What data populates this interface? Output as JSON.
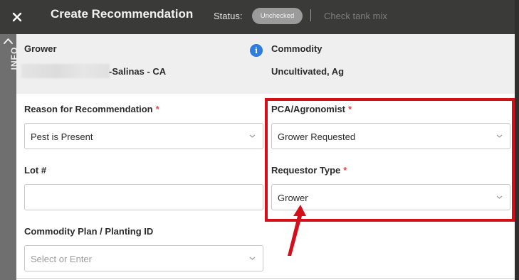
{
  "header": {
    "title": "Create Recommendation",
    "status_label": "Status:",
    "status_value": "Unchecked",
    "divider": "|",
    "tank_mix_link": "Check tank mix",
    "close_icon": "close-icon"
  },
  "info_rail": {
    "label": "INFO",
    "icon": "chevron-up-icon"
  },
  "info_panel": {
    "grower_heading": "Grower",
    "grower_value": "-Salinas - CA",
    "commodity_heading": "Commodity",
    "commodity_value": "Uncultivated, Ag",
    "info_icon_glyph": "i"
  },
  "form": {
    "reason": {
      "label": "Reason for Recommendation",
      "required": "*",
      "value": "Pest is Present"
    },
    "pca": {
      "label": "PCA/Agronomist",
      "required": "*",
      "value": "Grower Requested"
    },
    "lot": {
      "label": "Lot #",
      "value": ""
    },
    "requestor": {
      "label": "Requestor Type",
      "required": "*",
      "value": "Grower"
    },
    "plan": {
      "label": "Commodity Plan / Planting ID",
      "placeholder": "Select or Enter"
    }
  },
  "colors": {
    "header_bg": "#3a3a38",
    "info_panel_bg": "#efefef",
    "rail_bg": "#6f6f6f",
    "status_pill": "#9b9b9b",
    "required_star": "#e24a4a",
    "highlight": "#d40f1a",
    "info_icon": "#2f7de1"
  }
}
